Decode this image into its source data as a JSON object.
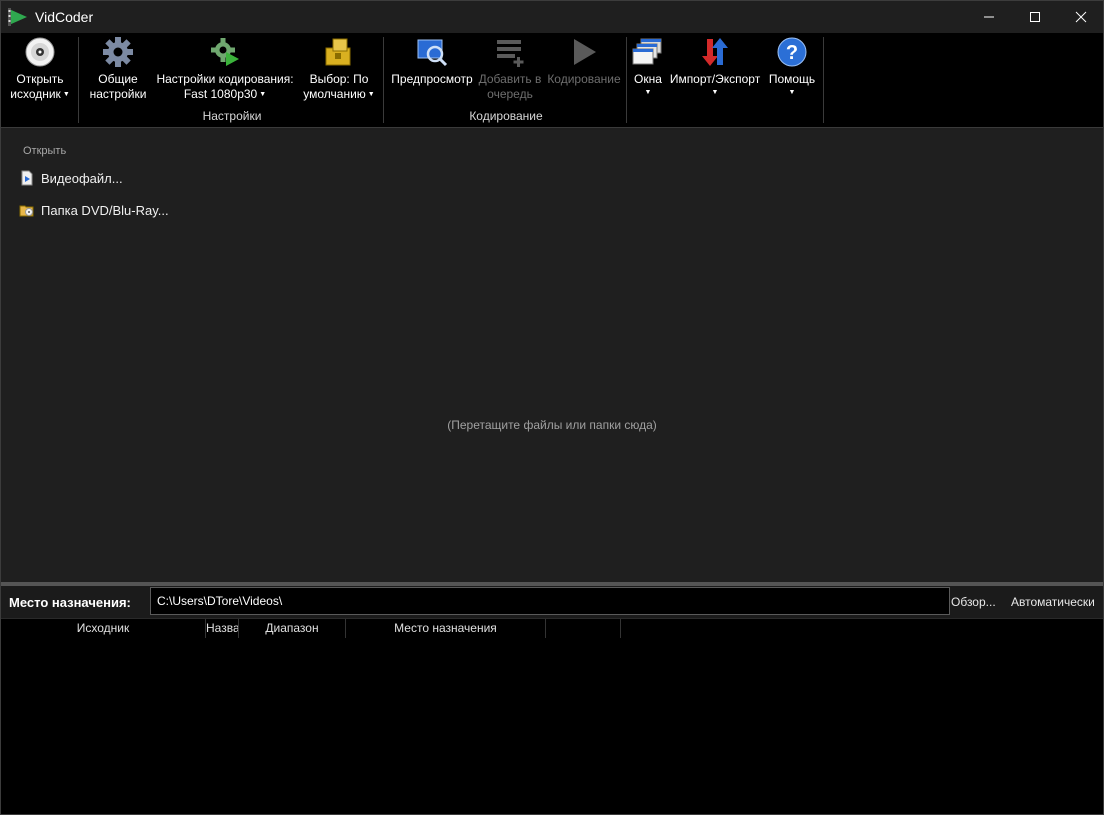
{
  "window": {
    "title": "VidCoder"
  },
  "toolbar": {
    "open_source": {
      "line1": "Открыть",
      "line2": "исходник"
    },
    "general_settings": {
      "line1": "Общие",
      "line2": "настройки"
    },
    "encoding_settings": {
      "line1": "Настройки кодирования:",
      "line2": "Fast 1080p30"
    },
    "picker": {
      "line1": "Выбор: По",
      "line2": "умолчанию"
    },
    "preview": {
      "line1": "Предпросмотр"
    },
    "add_to_queue": {
      "line1": "Добавить в",
      "line2": "очередь"
    },
    "encode": {
      "line1": "Кодирование"
    },
    "windows": {
      "line1": "Окна"
    },
    "import_export": {
      "line1": "Импорт/Экспорт"
    },
    "help": {
      "line1": "Помощь"
    },
    "groups": {
      "settings": "Настройки",
      "encoding": "Кодирование"
    }
  },
  "source": {
    "heading": "Открыть",
    "video_file": "Видеофайл...",
    "dvd_folder": "Папка DVD/Blu-Ray...",
    "drop_hint": "(Перетащите файлы или папки сюда)"
  },
  "destination": {
    "label": "Место назначения:",
    "path": "C:\\Users\\DTore\\Videos\\",
    "browse": "Обзор...",
    "auto": "Автоматически"
  },
  "queue": {
    "columns": [
      "Исходник",
      "Назва",
      "Диапазон",
      "Место назначения",
      ""
    ]
  },
  "colors": {
    "background": "#000000",
    "panel": "#1f1f1f",
    "help_blue": "#2b6fd6",
    "encode_green": "#3bb33b"
  }
}
